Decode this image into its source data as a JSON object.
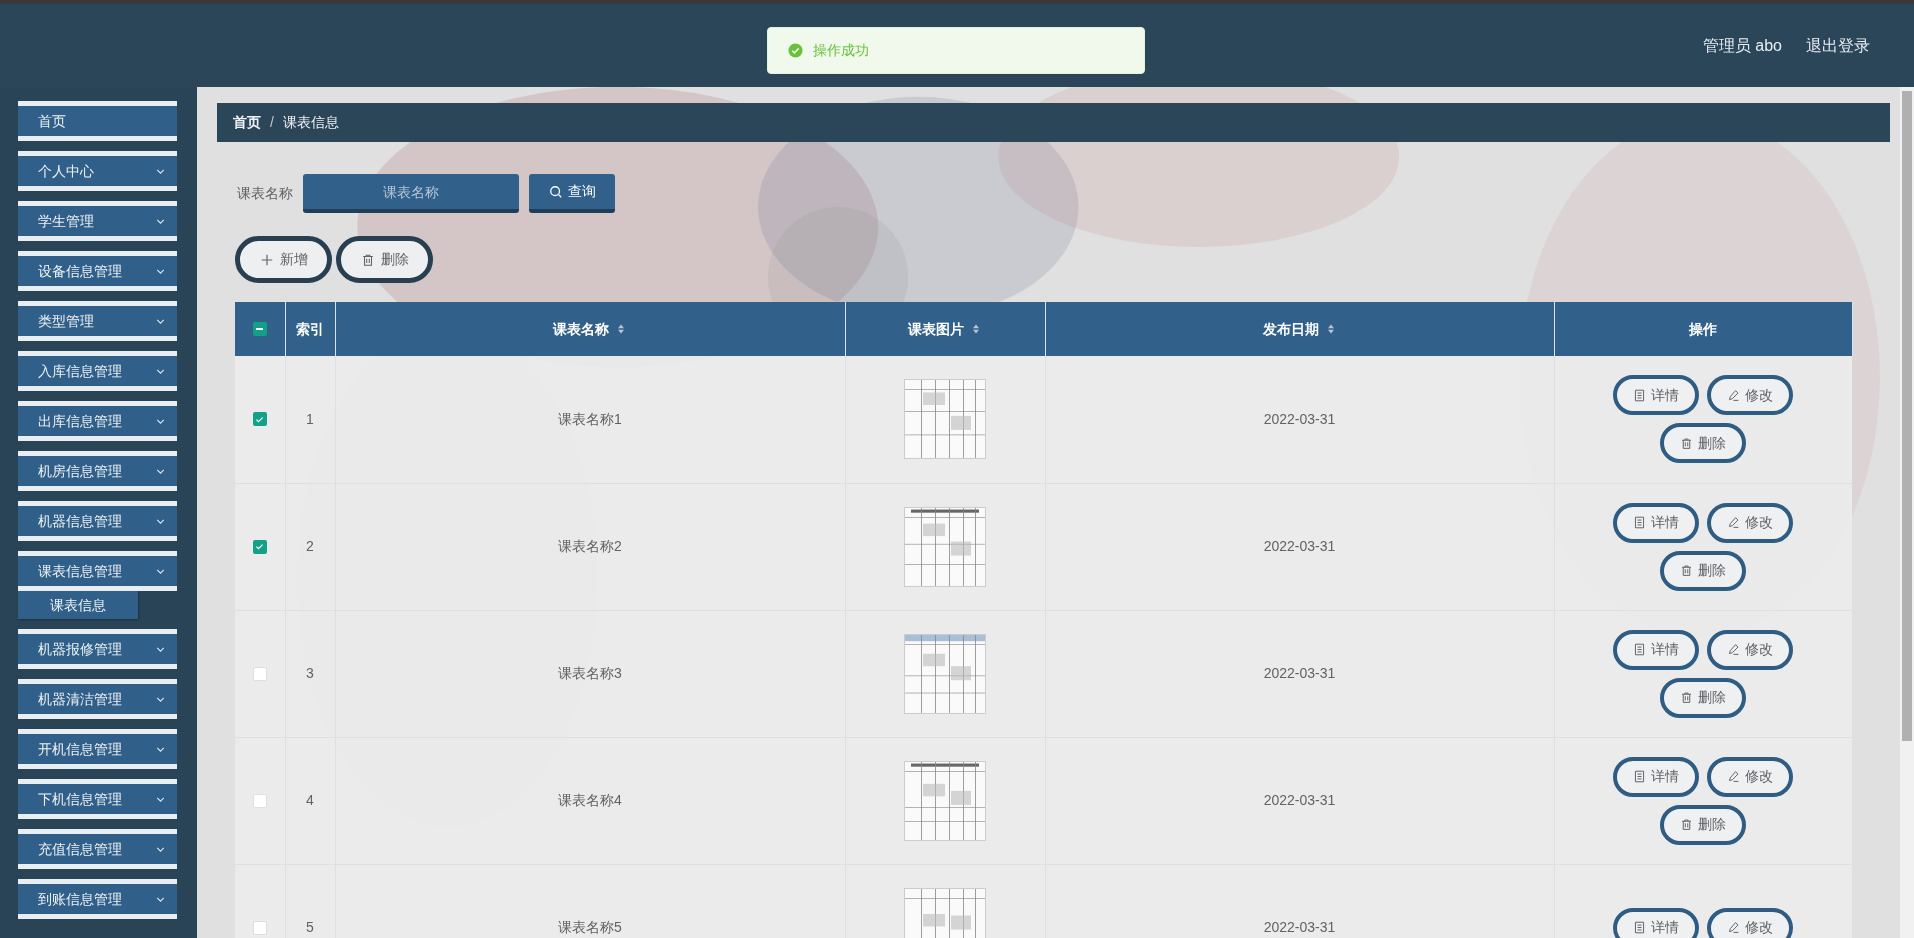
{
  "header": {
    "toast": {
      "kind": "success",
      "text": "操作成功"
    },
    "user": "管理员 abo",
    "logout": "退出登录"
  },
  "sidebar": {
    "items": [
      {
        "kind": "link",
        "label": "首页"
      },
      {
        "kind": "menu",
        "label": "个人中心"
      },
      {
        "kind": "menu",
        "label": "学生管理"
      },
      {
        "kind": "menu",
        "label": "设备信息管理"
      },
      {
        "kind": "menu",
        "label": "类型管理"
      },
      {
        "kind": "menu",
        "label": "入库信息管理"
      },
      {
        "kind": "menu",
        "label": "出库信息管理"
      },
      {
        "kind": "menu",
        "label": "机房信息管理"
      },
      {
        "kind": "menu",
        "label": "机器信息管理"
      },
      {
        "kind": "menu",
        "label": "课表信息管理",
        "children": [
          {
            "label": "课表信息"
          }
        ]
      },
      {
        "kind": "menu",
        "label": "机器报修管理"
      },
      {
        "kind": "menu",
        "label": "机器清洁管理"
      },
      {
        "kind": "menu",
        "label": "开机信息管理"
      },
      {
        "kind": "menu",
        "label": "下机信息管理"
      },
      {
        "kind": "menu",
        "label": "充值信息管理"
      },
      {
        "kind": "menu",
        "label": "到账信息管理"
      }
    ]
  },
  "breadcrumb": {
    "separator": "/",
    "items": [
      {
        "label": "首页",
        "current": false
      },
      {
        "label": "课表信息",
        "current": true
      }
    ]
  },
  "search": {
    "label": "课表名称",
    "placeholder": "课表名称",
    "button": "查询"
  },
  "toolbar": [
    {
      "kind": "add",
      "label": "新增"
    },
    {
      "kind": "delete",
      "label": "删除"
    }
  ],
  "table": {
    "select_all": {
      "indeterminate": true
    },
    "columns": [
      {
        "label": "索引",
        "sortable": false
      },
      {
        "label": "课表名称",
        "sortable": true
      },
      {
        "label": "课表图片",
        "sortable": true
      },
      {
        "label": "发布日期",
        "sortable": true
      },
      {
        "label": "操作",
        "sortable": false
      }
    ],
    "rows": [
      {
        "checked": true,
        "index": "1",
        "name": "课表名称1",
        "image": {
          "kind": "picture"
        },
        "date": "2022-03-31",
        "actions": [
          {
            "kind": "detail",
            "label": "详情"
          },
          {
            "kind": "edit",
            "label": "修改"
          },
          {
            "kind": "delete",
            "label": "删除"
          }
        ]
      },
      {
        "checked": true,
        "index": "2",
        "name": "课表名称2",
        "image": {
          "kind": "picture"
        },
        "date": "2022-03-31",
        "actions": [
          {
            "kind": "detail",
            "label": "详情"
          },
          {
            "kind": "edit",
            "label": "修改"
          },
          {
            "kind": "delete",
            "label": "删除"
          }
        ]
      },
      {
        "checked": false,
        "index": "3",
        "name": "课表名称3",
        "image": {
          "kind": "picture"
        },
        "date": "2022-03-31",
        "actions": [
          {
            "kind": "detail",
            "label": "详情"
          },
          {
            "kind": "edit",
            "label": "修改"
          },
          {
            "kind": "delete",
            "label": "删除"
          }
        ]
      },
      {
        "checked": false,
        "index": "4",
        "name": "课表名称4",
        "image": {
          "kind": "picture"
        },
        "date": "2022-03-31",
        "actions": [
          {
            "kind": "detail",
            "label": "详情"
          },
          {
            "kind": "edit",
            "label": "修改"
          },
          {
            "kind": "delete",
            "label": "删除"
          }
        ]
      },
      {
        "checked": false,
        "index": "5",
        "name": "课表名称5",
        "image": {
          "kind": "picture"
        },
        "date": "2022-03-31",
        "actions": [
          {
            "kind": "detail",
            "label": "详情"
          },
          {
            "kind": "edit",
            "label": "修改"
          }
        ]
      }
    ]
  }
}
